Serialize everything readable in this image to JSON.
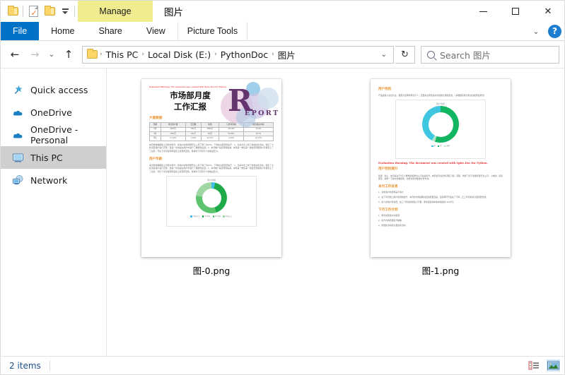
{
  "window": {
    "title": "图片",
    "contextual_tab": "Manage",
    "minimize": "—",
    "maximize": "□",
    "close": "✕"
  },
  "quick_access_toolbar": {
    "items": [
      {
        "name": "folder-icon",
        "label": ""
      },
      {
        "name": "properties-icon",
        "label": ""
      },
      {
        "name": "new-folder-icon",
        "label": ""
      },
      {
        "name": "customize-caret-icon",
        "label": ""
      }
    ]
  },
  "ribbon": {
    "tabs": [
      {
        "label": "File",
        "active_style": "file"
      },
      {
        "label": "Home",
        "active_style": "normal"
      },
      {
        "label": "Share",
        "active_style": "normal"
      },
      {
        "label": "View",
        "active_style": "normal"
      },
      {
        "label": "Picture Tools",
        "active_style": "contextual"
      }
    ],
    "collapse_icon": "⌄",
    "help_label": "?"
  },
  "address": {
    "back": "←",
    "forward": "→",
    "recent": "⌄",
    "up": "↑",
    "breadcrumbs": [
      "This PC",
      "Local Disk (E:)",
      "PythonDoc",
      "图片"
    ],
    "separator": "›",
    "dropdown": "⌄",
    "refresh": "↻"
  },
  "search": {
    "placeholder": "Search 图片",
    "value": ""
  },
  "sidebar": {
    "items": [
      {
        "label": "Quick access",
        "icon": "star-pin-icon",
        "selected": false
      },
      {
        "label": "OneDrive",
        "icon": "cloud-icon",
        "selected": false
      },
      {
        "label": "OneDrive - Personal",
        "icon": "cloud-icon",
        "selected": false
      },
      {
        "label": "This PC",
        "icon": "monitor-icon",
        "selected": true
      },
      {
        "label": "Network",
        "icon": "network-icon",
        "selected": false
      }
    ]
  },
  "files": [
    {
      "name": "图-0.png",
      "preview": {
        "eval_warning": "Evaluation Warning: The document was created with Spire.Doc for Python.",
        "title_line1": "市场部月度",
        "title_line2": "工作汇报",
        "logo_letter": "R",
        "logo_word": "EPORT",
        "section1_heading": "大盘数据",
        "table": {
          "headers": [
            "日期",
            "累计用户量",
            "日活数",
            "新增",
            "与去年同期",
            "服务器占内存"
          ],
          "rows": [
            [
              "6月",
              "2023万",
              "341万",
              "1890万",
              "30.12%",
              "31.2G"
            ],
            [
              "5月",
              "1556万",
              "334万",
              "790万",
              "56.66%",
              "28.7G"
            ],
            [
              "环比",
              "17.22%",
              "1.49%",
              "12.37%",
              "-2.15%",
              "16.07%"
            ]
          ]
        },
        "paragraph1": "本月整体数据较上月稳中有升，新用户的新增量环比上月下降了约10%，下降的主要原因在于：1、竞争对手上线了新的拉新活动，吸引了大批活跃用户进行迁移；更进一步的是在用户中进行了精细化运营。2、本月推广渠道预算缩减，本月第一梯队第一波会员到期用户月留存上了了台阶，环比下半月留存率虽然上涨有所回落，整体对下月有不少的挑战压力。",
        "section2_heading": "用户年龄",
        "chart_title": "用户年龄",
        "legend": [
          "18岁以下",
          "18-25岁",
          "26-35岁",
          "36岁以上"
        ]
      }
    },
    {
      "name": "图-1.png",
      "preview": {
        "section1_heading": "用户性别",
        "paragraph1": "产品运营以女性为主，但因为近两年男性不少，还要关注男性用户的使用比例和变化，（请根据实际分析女性和男性增长）",
        "chart_title": "用户性别",
        "legend": [
          "男",
          "女",
          "未知"
        ],
        "eval_warning": "Evaluation Warning: The document was created with Spire.Doc for Python.",
        "section2_heading": "用户性别提升",
        "paragraph2": "底部、线上、本月底关于3万人群构建和整合公司业绩提升，本阶段与综合情况和了解。同期、新增了值不含服务器与合公司、小城划、运营部定、新增一下的分析推送项，新增对增长数量分析方向。",
        "section3_heading": "本月工作反思",
        "list1": [
          "1、对新用户新增率是不够大",
          "2、在下半月线上用户使用的提升，本月的市场战略总结的度量还是，运营率环节会在了下降，正上半月未来分量需要优化。",
          "3、新人的用户转化低，在三个阶段的增加小不量，率的运营成本和本期指标 19.65万。"
        ],
        "section4_heading": "下月工作计划",
        "list2": [
          "1、整合加强用户的拓展",
          "2、提升内容质量提升策略",
          "3、增强的活动和大量运营活动"
        ]
      }
    }
  ],
  "chart_data": [
    {
      "type": "pie",
      "title": "用户年龄",
      "doc": "图-0.png",
      "labels": [
        "18岁以下",
        "18-25岁",
        "26-35岁",
        "36岁以上"
      ],
      "values": [
        4,
        41,
        32,
        23
      ],
      "colors": [
        "#3fbfe2",
        "#1faa4a",
        "#5cc46f",
        "#9fd8a2"
      ],
      "legend_position": "bottom",
      "grid": false
    },
    {
      "type": "pie",
      "title": "用户性别",
      "doc": "图-1.png",
      "labels": [
        "男",
        "女",
        "未知"
      ],
      "values": [
        42,
        55,
        3
      ],
      "colors": [
        "#3fc6e0",
        "#12b561",
        "#b3e5cc"
      ],
      "legend_position": "bottom",
      "grid": false
    }
  ],
  "statusbar": {
    "item_count": "2 items",
    "view_details_icon": "details-view-icon",
    "view_large_icons_icon": "large-icons-view-icon"
  },
  "colors": {
    "accent_blue": "#0072c6",
    "contextual_yellow": "#f2ec90",
    "selection_gray": "#cfcfcf",
    "status_text": "#1b4e8e",
    "warning_red": "#ef2b2b",
    "heading_orange": "#e8902c"
  }
}
